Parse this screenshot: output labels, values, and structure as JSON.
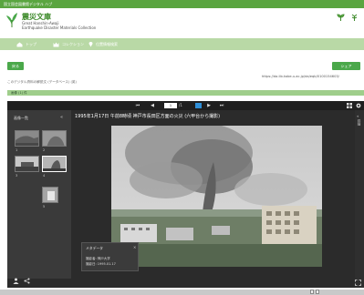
{
  "topbar": {
    "text": "国立国会図書館デジタル ハブ"
  },
  "brand": {
    "title": "震災文庫",
    "subtitle_en": "Great Hanshin-Awaji",
    "subtitle_en2": "Earthquake Disaster Materials Collection"
  },
  "nav": [
    {
      "label": "トップ",
      "icon": "home-icon"
    },
    {
      "label": "コレクション",
      "icon": "crown-icon"
    },
    {
      "label": "位置情報検索",
      "icon": "map-pin-icon"
    }
  ],
  "actions": {
    "back_label": "戻る",
    "share_label": "シェア"
  },
  "permalink": {
    "url": "https://da.lib.kobe-u.ac.jp/da/eqb/0100154603/"
  },
  "meta": {
    "line": "このデジタル資料の解説文 (データベース) (英)"
  },
  "filter": {
    "label": "画像 (1) 件"
  },
  "viewer": {
    "page_current": "1",
    "page_total": "/1",
    "sidebar_title": "画像一覧",
    "image_title": "1995年1月17日 午前8時頃 神戸市長田区方面の火災 (六甲台から撮影)",
    "thumbs": [
      "1",
      "2",
      "3",
      "4",
      "5"
    ],
    "right_rail_label": "詳細",
    "info": {
      "title": "メタデータ",
      "line1": "撮影者: 神戸大学",
      "line2": "撮影日: 1995.01.17"
    }
  },
  "colors": {
    "accent": "#5aa540",
    "nav": "#b9d9a6",
    "button": "#4aa84a",
    "viewer_bg": "#2b2b2b"
  }
}
